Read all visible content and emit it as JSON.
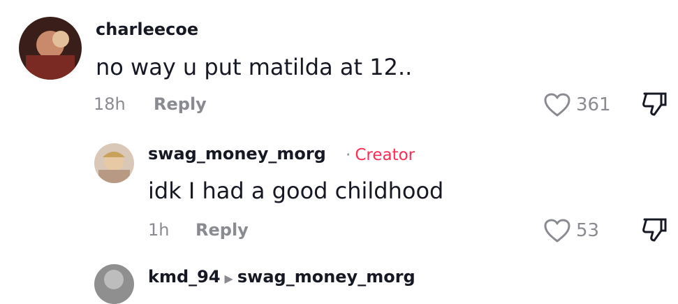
{
  "comments": [
    {
      "username": "charleecoe",
      "text": "no way u put matilda at 12..",
      "time": "18h",
      "reply_label": "Reply",
      "likes": "361"
    }
  ],
  "replies": [
    {
      "username": "swag_money_morg",
      "separator": "·",
      "badge": "Creator",
      "text": "idk I had a good childhood",
      "time": "1h",
      "reply_label": "Reply",
      "likes": "53"
    }
  ],
  "next_reply": {
    "username": "kmd_94",
    "arrow": "▶",
    "reply_to": "swag_money_morg"
  },
  "colors": {
    "primary_text": "#161823",
    "secondary_text": "#8a8b91",
    "creator_badge": "#fe2c55"
  },
  "icons": [
    "heart-outline-icon",
    "thumbs-down-icon"
  ]
}
